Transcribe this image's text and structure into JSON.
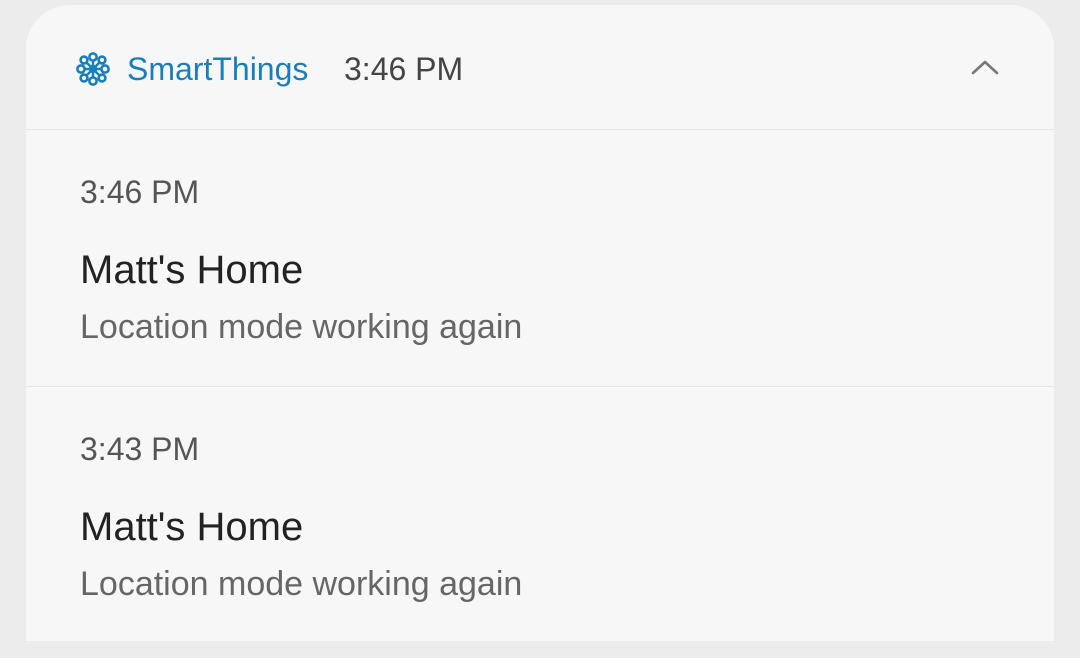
{
  "header": {
    "app_icon": "smartthings-icon",
    "app_name": "SmartThings",
    "time": "3:46 PM",
    "collapse_icon": "chevron-up-icon",
    "accent_color": "#1a7fb8"
  },
  "notifications": [
    {
      "time": "3:46 PM",
      "title": "Matt's Home",
      "body": "Location mode working again"
    },
    {
      "time": "3:43 PM",
      "title": "Matt's Home",
      "body": "Location mode working again"
    }
  ]
}
